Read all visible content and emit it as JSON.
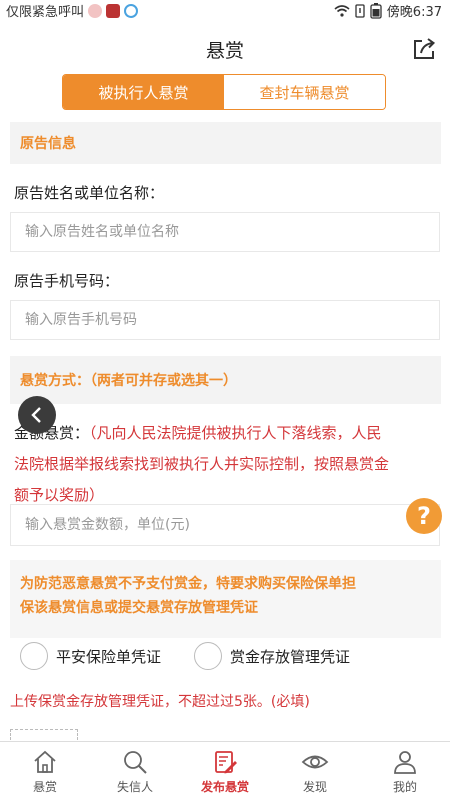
{
  "status_bar": {
    "left_text": "仅限紧急呼叫",
    "right_text": "傍晚6:37"
  },
  "header": {
    "title": "悬赏"
  },
  "tabs": [
    {
      "label": "被执行人悬赏",
      "active": true
    },
    {
      "label": "查封车辆悬赏",
      "active": false
    }
  ],
  "plaintiff": {
    "section_title": "原告信息",
    "name_label": "原告姓名或单位名称：",
    "name_placeholder": "输入原告姓名或单位名称",
    "phone_label": "原告手机号码：",
    "phone_placeholder": "输入原告手机号码"
  },
  "reward": {
    "section_title": "悬赏方式：（两者可并存或选其一）",
    "cash_label_prefix": "金额悬赏：",
    "cash_desc_line1": "（凡向人民法院提供被执行人下落线索，人民",
    "cash_desc_line2": "法院根据举报线索找到被执行人并实际控制，按照悬赏金",
    "cash_desc_line3": "额予以奖励）",
    "amount_placeholder": "输入悬赏金数额，单位(元)"
  },
  "notice": {
    "line1": "为防范恶意悬赏不予支付赏金，特要求购买保险保单担",
    "line2": "保该悬赏信息或提交悬赏存放管理凭证"
  },
  "options": [
    {
      "label": "平安保险单凭证"
    },
    {
      "label": "赏金存放管理凭证"
    }
  ],
  "upload_note": "上传保赏金存放管理凭证，不超过过5张。(必填)",
  "bottom_nav": [
    {
      "label": "悬赏",
      "icon": "home-icon",
      "active": false
    },
    {
      "label": "失信人",
      "icon": "search-icon",
      "active": false
    },
    {
      "label": "发布悬赏",
      "icon": "edit-icon",
      "active": true
    },
    {
      "label": "发现",
      "icon": "eye-icon",
      "active": false
    },
    {
      "label": "我的",
      "icon": "person-icon",
      "active": false
    }
  ],
  "colors": {
    "accent": "#ee8c2c",
    "alert_red": "#d4373a",
    "section_bg": "#f3f3f3"
  }
}
